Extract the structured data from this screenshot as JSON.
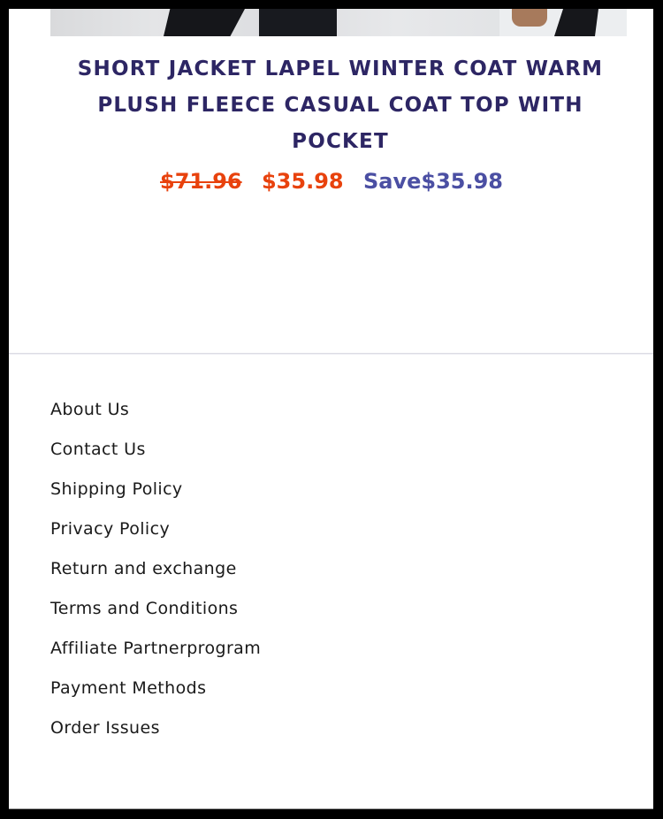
{
  "product": {
    "title": "SHORT JACKET LAPEL WINTER COAT WARM PLUSH FLEECE CASUAL COAT TOP WITH POCKET",
    "image_alt": "product-photo",
    "price": {
      "original": "$71.96",
      "sale": "$35.98",
      "save": "Save$35.98"
    }
  },
  "colors": {
    "title": "#2d2664",
    "sale_price": "#e8420d",
    "save_text": "#4b4fa3"
  },
  "footer": {
    "links": [
      {
        "label": "About Us"
      },
      {
        "label": "Contact Us"
      },
      {
        "label": "Shipping Policy"
      },
      {
        "label": "Privacy Policy"
      },
      {
        "label": "Return and exchange"
      },
      {
        "label": "Terms and Conditions"
      },
      {
        "label": "Affiliate Partnerprogram"
      },
      {
        "label": "Payment Methods"
      },
      {
        "label": "Order Issues"
      }
    ]
  }
}
